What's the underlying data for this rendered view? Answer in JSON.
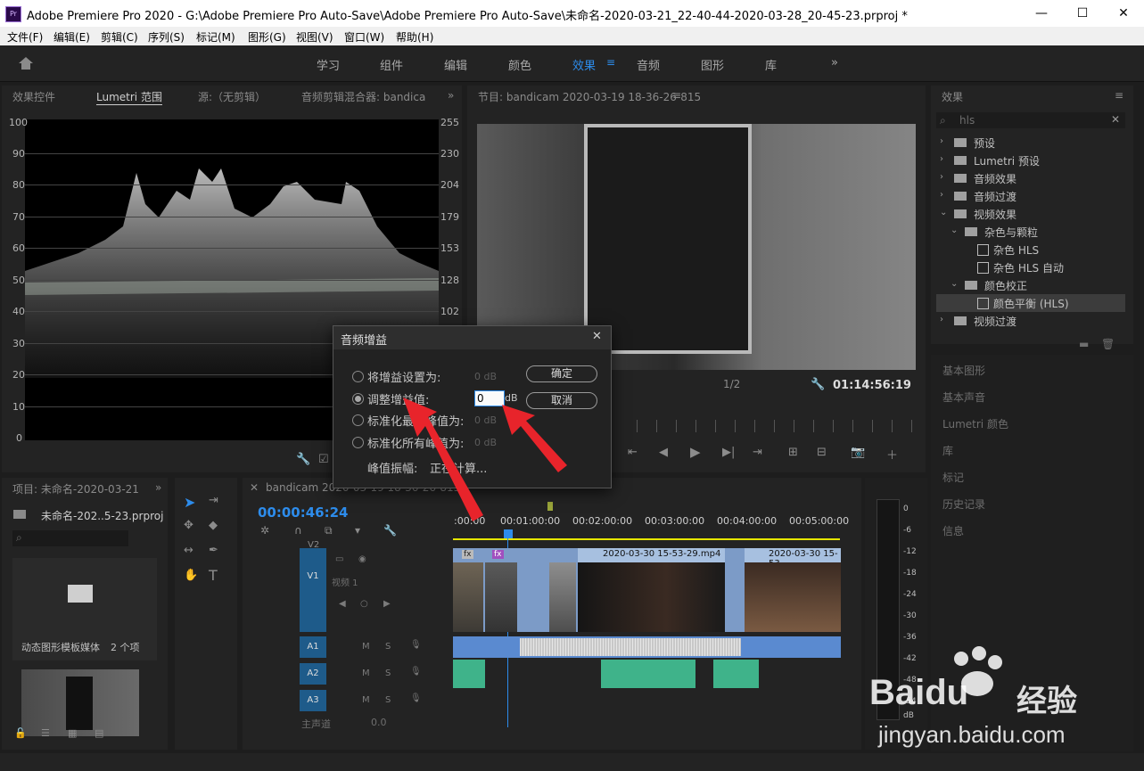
{
  "window": {
    "title": "Adobe Premiere Pro 2020 - G:\\Adobe Premiere Pro Auto-Save\\Adobe Premiere Pro Auto-Save\\未命名-2020-03-21_22-40-44-2020-03-28_20-45-23.prproj *",
    "app_icon_text": "Pr",
    "minimize": "—",
    "maximize": "☐",
    "close": "✕"
  },
  "menu": [
    "文件(F)",
    "编辑(E)",
    "剪辑(C)",
    "序列(S)",
    "标记(M)",
    "图形(G)",
    "视图(V)",
    "窗口(W)",
    "帮助(H)"
  ],
  "workspaces": {
    "home_icon": "home-icon",
    "tabs": [
      "学习",
      "组件",
      "编辑",
      "颜色",
      "效果",
      "音频",
      "图形",
      "库"
    ],
    "active": "效果",
    "more": "»"
  },
  "scope_panel": {
    "tabs": [
      "效果控件",
      "Lumetri 范围",
      "源:（无剪辑）",
      "音频剪辑混合器: bandica"
    ],
    "active_tab": "Lumetri 范围",
    "left_scale": [
      "100",
      "90",
      "80",
      "70",
      "60",
      "50",
      "40",
      "30",
      "20",
      "10",
      "0"
    ],
    "right_scale": [
      "255",
      "230",
      "204",
      "179",
      "153",
      "128",
      "102"
    ]
  },
  "program_monitor": {
    "title": "节目: bandicam 2020-03-19 18-36-26-815",
    "zoom_select": "",
    "resolution": "1/2",
    "timecode": "01:14:56:19"
  },
  "effects_panel": {
    "title": "效果",
    "search_value": "hls",
    "items": [
      {
        "label": "预设",
        "kind": "preset-folder",
        "level": 0,
        "expanded": false
      },
      {
        "label": "Lumetri 预设",
        "kind": "preset-folder",
        "level": 0,
        "expanded": false
      },
      {
        "label": "音频效果",
        "kind": "folder",
        "level": 0,
        "expanded": false
      },
      {
        "label": "音频过渡",
        "kind": "folder",
        "level": 0,
        "expanded": false
      },
      {
        "label": "视频效果",
        "kind": "folder",
        "level": 0,
        "expanded": true
      },
      {
        "label": "杂色与颗粒",
        "kind": "folder",
        "level": 1,
        "expanded": true
      },
      {
        "label": "杂色 HLS",
        "kind": "effect",
        "level": 2
      },
      {
        "label": "杂色 HLS 自动",
        "kind": "effect",
        "level": 2
      },
      {
        "label": "颜色校正",
        "kind": "folder",
        "level": 1,
        "expanded": true
      },
      {
        "label": "颜色平衡 (HLS)",
        "kind": "effect",
        "level": 2,
        "selected": true
      },
      {
        "label": "视频过渡",
        "kind": "folder",
        "level": 0,
        "expanded": false
      }
    ],
    "side_sections": [
      "基本图形",
      "基本声音",
      "Lumetri 颜色",
      "库",
      "标记",
      "历史记录",
      "信息"
    ]
  },
  "project_panel": {
    "title": "项目: 未命名-2020-03-21",
    "file": "未命名-202..5-23.prproj",
    "bin_label": "动态图形模板媒体",
    "bin_count": "2 个项"
  },
  "timeline": {
    "sequence_tab": "bandicam 2020-03-19 18-36-26-815",
    "timecode": "00:00:46:24",
    "ruler": [
      ":00:00",
      "00:01:00:00",
      "00:02:00:00",
      "00:03:00:00",
      "00:04:00:00",
      "00:05:00:00"
    ],
    "tracks": {
      "v2": "V2",
      "v1": "V1",
      "v1_name": "视频 1",
      "a1": "A1",
      "a2": "A2",
      "a3": "A3",
      "master": "主声道",
      "master_value": "0.0"
    },
    "mute": "M",
    "solo": "S",
    "clips": [
      "2020-03-30 15-53-29.mp4",
      "2020-03-30 15-53-"
    ],
    "fx_badge": "fx"
  },
  "audio_meter": {
    "scale": [
      "0",
      "-6",
      "-12",
      "-18",
      "-24",
      "-30",
      "-36",
      "-42",
      "-48",
      "-54"
    ],
    "unit": "dB"
  },
  "dialog": {
    "title": "音频增益",
    "close": "✕",
    "options": [
      {
        "label": "将增益设置为:",
        "value": "0 dB",
        "selected": false
      },
      {
        "label": "调整增益值:",
        "value": "0",
        "unit": "dB",
        "selected": true
      },
      {
        "label": "标准化最大峰值为:",
        "value": "0 dB",
        "selected": false
      },
      {
        "label": "标准化所有峰值为:",
        "value": "0 dB",
        "selected": false
      }
    ],
    "peak_label": "峰值振幅:",
    "peak_value": "正在计算...",
    "ok": "确定",
    "cancel": "取消"
  },
  "watermark": {
    "brand": "Baidu",
    "suffix": "经验",
    "url": "jingyan.baidu.com"
  },
  "colors": {
    "accent": "#2d8ceb",
    "video_track": "#1e5b8a",
    "audio_clip": "#3fb38a",
    "arrow": "#e8242b"
  }
}
